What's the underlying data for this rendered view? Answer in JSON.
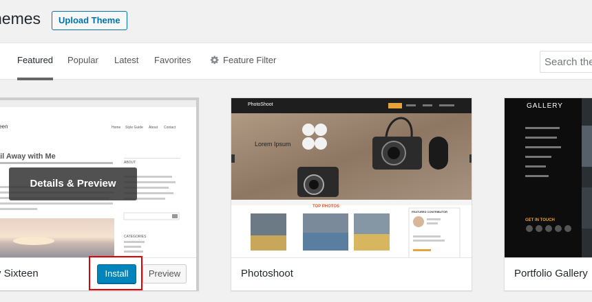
{
  "header": {
    "title": "hemes",
    "upload_label": "Upload Theme"
  },
  "filter": {
    "tabs": [
      {
        "label": "Featured"
      },
      {
        "label": "Popular"
      },
      {
        "label": "Latest"
      },
      {
        "label": "Favorites"
      },
      {
        "label": "Feature Filter"
      }
    ],
    "search_value": "Search the"
  },
  "themes": [
    {
      "name": "y Sixteen",
      "overlay_label": "Details & Preview",
      "install_label": "Install",
      "preview_label": "Preview",
      "shot": {
        "site_title": "teen",
        "heading": "ail Away with Me",
        "nav": [
          "Home",
          "Style Guide",
          "About",
          "Contact"
        ],
        "sidebar_about": "ABOUT",
        "sidebar_categories": "CATEGORIES"
      }
    },
    {
      "name": "Photoshoot",
      "shot": {
        "logo": "PhotoShoot",
        "hero_title": "Lorem Ipsum",
        "section_title": "TOP PHOTOS",
        "contributor": "FEATURED CONTRIBUTOR"
      }
    },
    {
      "name": "Portfolio Gallery",
      "shot": {
        "logo": "GALLERY",
        "get_in_touch": "GET IN TOUCH"
      }
    }
  ],
  "colors": {
    "primary": "#0085ba",
    "highlight": "#e00000",
    "link": "#0073aa"
  }
}
